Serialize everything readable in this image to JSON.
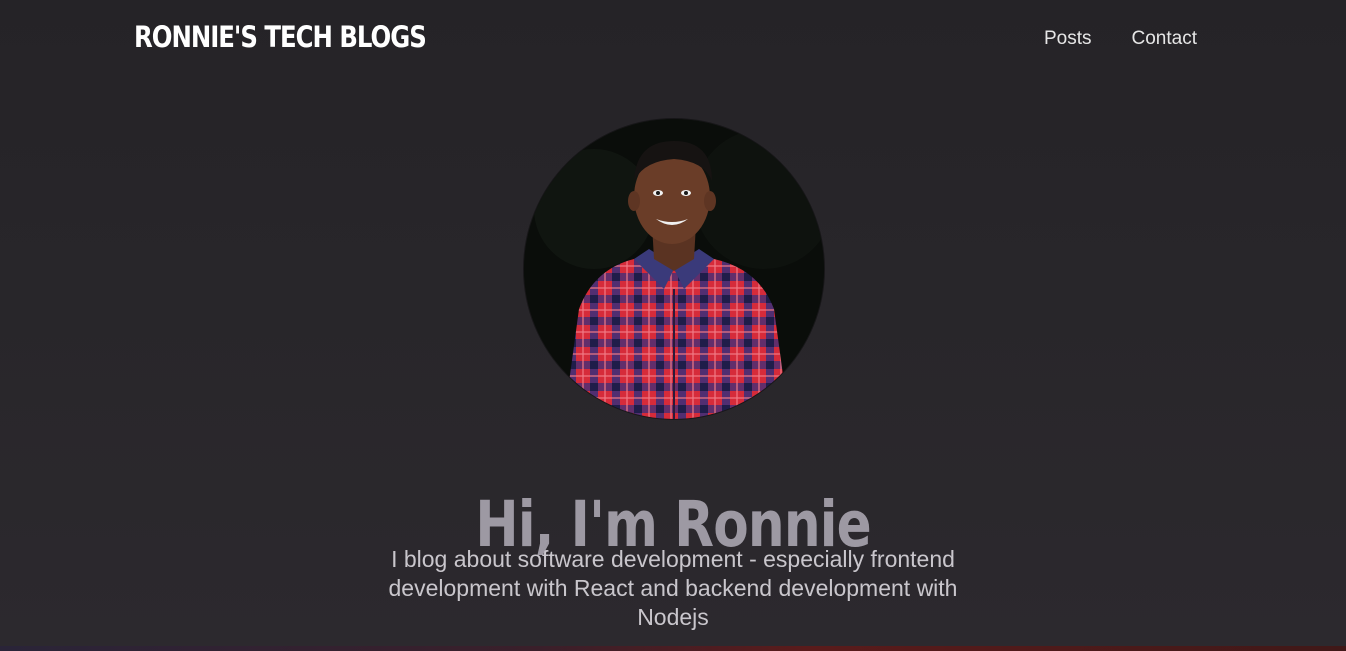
{
  "header": {
    "brand": "RONNIE'S TECH BLOGS",
    "nav": {
      "posts_label": "Posts",
      "contact_label": "Contact"
    }
  },
  "hero": {
    "title": "Hi, I'm Ronnie",
    "subtitle": "I blog about software development - especially frontend development with React and backend development with Nodejs"
  },
  "colors": {
    "background": "#28262a",
    "brand_text": "#ffffff",
    "title_text": "#9d99a3",
    "subtitle_text": "#c9c6cc"
  }
}
